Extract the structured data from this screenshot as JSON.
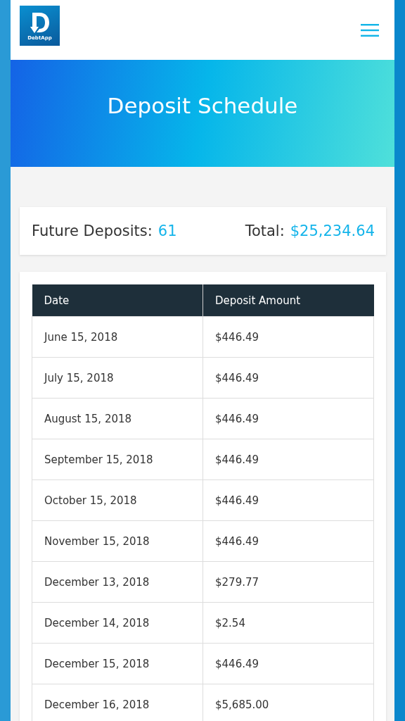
{
  "header": {
    "logo_text": "DebtApp"
  },
  "banner": {
    "title": "Deposit Schedule"
  },
  "summary": {
    "deposits_label": "Future Deposits:",
    "deposits_value": "61",
    "total_label": "Total:",
    "total_value": "$25,234.64"
  },
  "table": {
    "columns": [
      "Date",
      "Deposit Amount"
    ],
    "rows": [
      [
        "June 15, 2018",
        "$446.49"
      ],
      [
        "July 15, 2018",
        "$446.49"
      ],
      [
        "August 15, 2018",
        "$446.49"
      ],
      [
        "September 15, 2018",
        "$446.49"
      ],
      [
        "October 15, 2018",
        "$446.49"
      ],
      [
        "November 15, 2018",
        "$446.49"
      ],
      [
        "December 13, 2018",
        "$279.77"
      ],
      [
        "December 14, 2018",
        "$2.54"
      ],
      [
        "December 15, 2018",
        "$446.49"
      ],
      [
        "December 16, 2018",
        "$5,685.00"
      ]
    ]
  }
}
